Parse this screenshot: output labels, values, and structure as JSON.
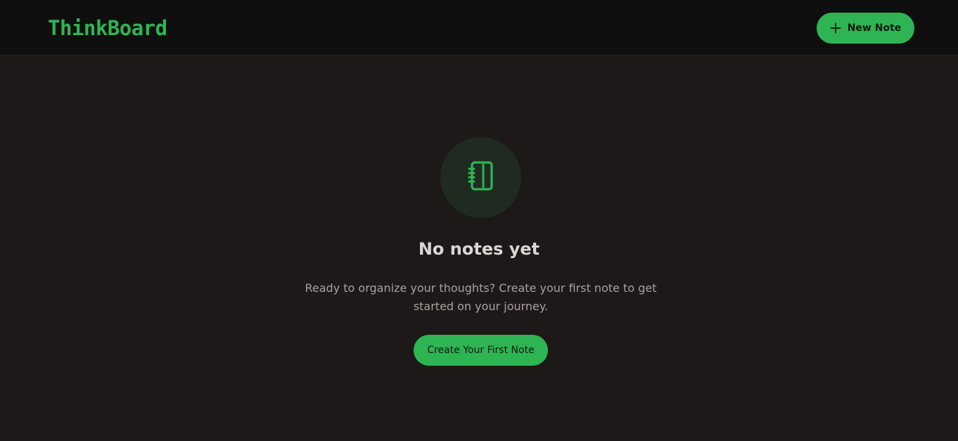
{
  "header": {
    "logo": "ThinkBoard",
    "new_note_label": "New Note",
    "new_note_icon": "plus-icon"
  },
  "empty_state": {
    "icon": "notebook-icon",
    "title": "No notes yet",
    "description": "Ready to organize your thoughts? Create your first note to get started on your journey.",
    "cta_label": "Create Your First Note"
  },
  "colors": {
    "background": "#1c1918",
    "header_background": "#0f0f0f",
    "accent": "#2fb454",
    "icon_circle": "#1f2b21",
    "title_text": "#d9d6d3",
    "body_text": "#a7a29e"
  }
}
